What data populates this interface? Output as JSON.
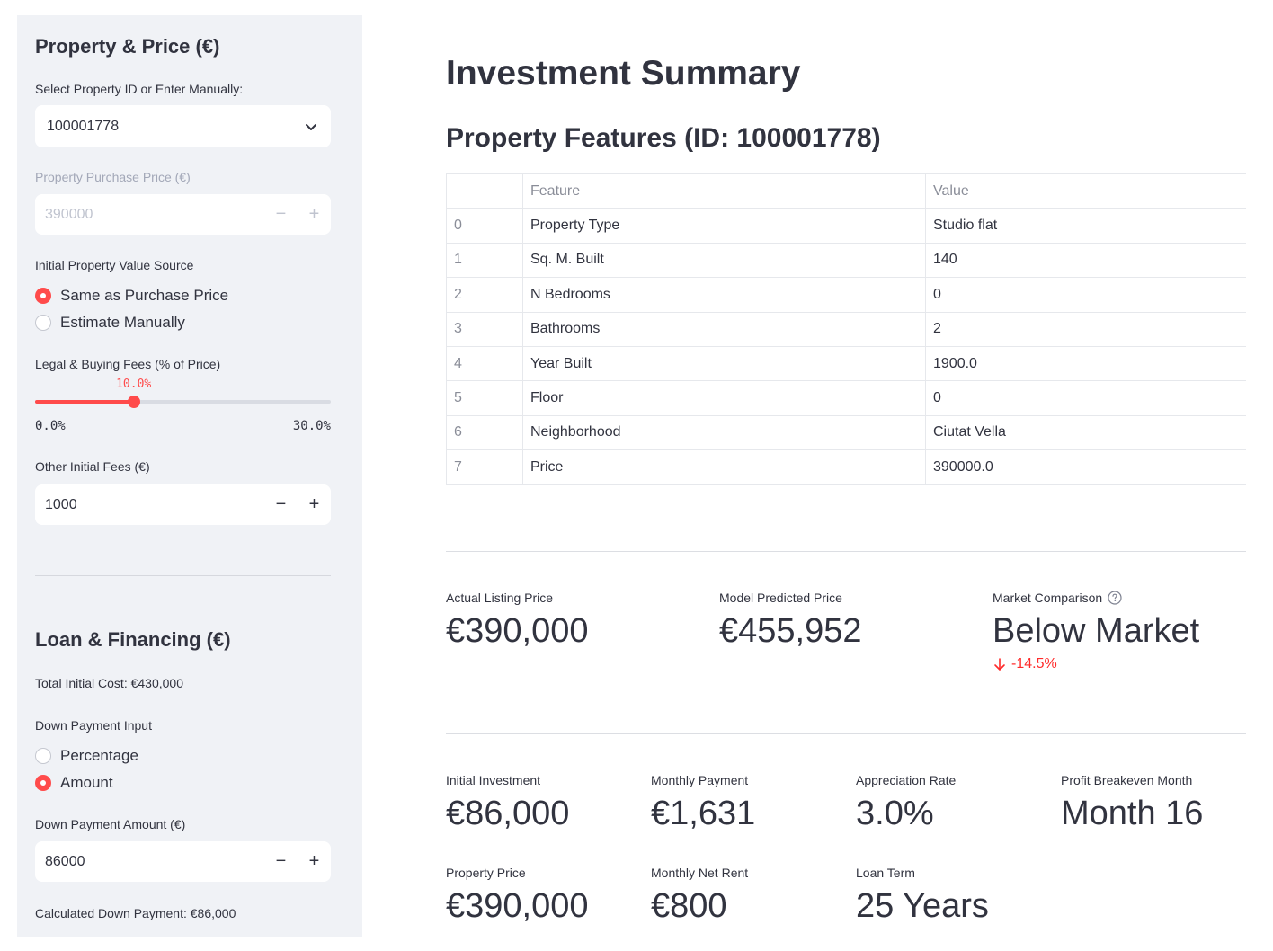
{
  "sidebar": {
    "property_section": {
      "title": "Property & Price (€)",
      "select_label": "Select Property ID or Enter Manually:",
      "select_value": "100001778",
      "purchase_price_label": "Property Purchase Price (€)",
      "purchase_price_value": "390000",
      "value_source_label": "Initial Property Value Source",
      "value_source_options": [
        "Same as Purchase Price",
        "Estimate Manually"
      ],
      "value_source_selected": "Same as Purchase Price",
      "fees_label": "Legal & Buying Fees (% of Price)",
      "fees_slider": {
        "value_text": "10.0%",
        "value": 10.0,
        "min": 0.0,
        "max": 30.0,
        "min_text": "0.0%",
        "max_text": "30.0%"
      },
      "other_fees_label": "Other Initial Fees (€)",
      "other_fees_value": "1000"
    },
    "loan_section": {
      "title": "Loan & Financing (€)",
      "total_initial_cost": "Total Initial Cost: €430,000",
      "down_payment_input_label": "Down Payment Input",
      "down_payment_options": [
        "Percentage",
        "Amount"
      ],
      "down_payment_selected": "Amount",
      "down_payment_amount_label": "Down Payment Amount (€)",
      "down_payment_amount_value": "86000",
      "calculated_down_payment": "Calculated Down Payment: €86,000"
    },
    "stepper": {
      "minus": "−",
      "plus": "+"
    }
  },
  "main": {
    "title": "Investment Summary",
    "features_title": "Property Features (ID: 100001778)",
    "table": {
      "headers": [
        "",
        "Feature",
        "Value"
      ],
      "rows": [
        [
          "0",
          "Property Type",
          "Studio flat"
        ],
        [
          "1",
          "Sq. M. Built",
          "140"
        ],
        [
          "2",
          "N Bedrooms",
          "0"
        ],
        [
          "3",
          "Bathrooms",
          "2"
        ],
        [
          "4",
          "Year Built",
          "1900.0"
        ],
        [
          "5",
          "Floor",
          "0"
        ],
        [
          "6",
          "Neighborhood",
          "Ciutat Vella"
        ],
        [
          "7",
          "Price",
          "390000.0"
        ]
      ]
    },
    "price_metrics": [
      {
        "label": "Actual Listing Price",
        "value": "€390,000"
      },
      {
        "label": "Model Predicted Price",
        "value": "€455,952"
      },
      {
        "label": "Market Comparison",
        "value": "Below Market",
        "delta": "-14.5%",
        "help_icon": "question-circle-icon",
        "delta_icon": "arrow-down-icon"
      }
    ],
    "summary_metrics": [
      {
        "label": "Initial Investment",
        "value": "€86,000"
      },
      {
        "label": "Monthly Payment",
        "value": "€1,631"
      },
      {
        "label": "Appreciation Rate",
        "value": "3.0%"
      },
      {
        "label": "Profit Breakeven Month",
        "value": "Month 16"
      },
      {
        "label": "Property Price",
        "value": "€390,000"
      },
      {
        "label": "Monthly Net Rent",
        "value": "€800"
      },
      {
        "label": "Loan Term",
        "value": "25 Years"
      }
    ]
  },
  "colors": {
    "accent": "#ff4b4b",
    "sidebar_bg": "#f0f2f6",
    "text": "#31333f",
    "delta_negative": "#ff2b2b"
  }
}
